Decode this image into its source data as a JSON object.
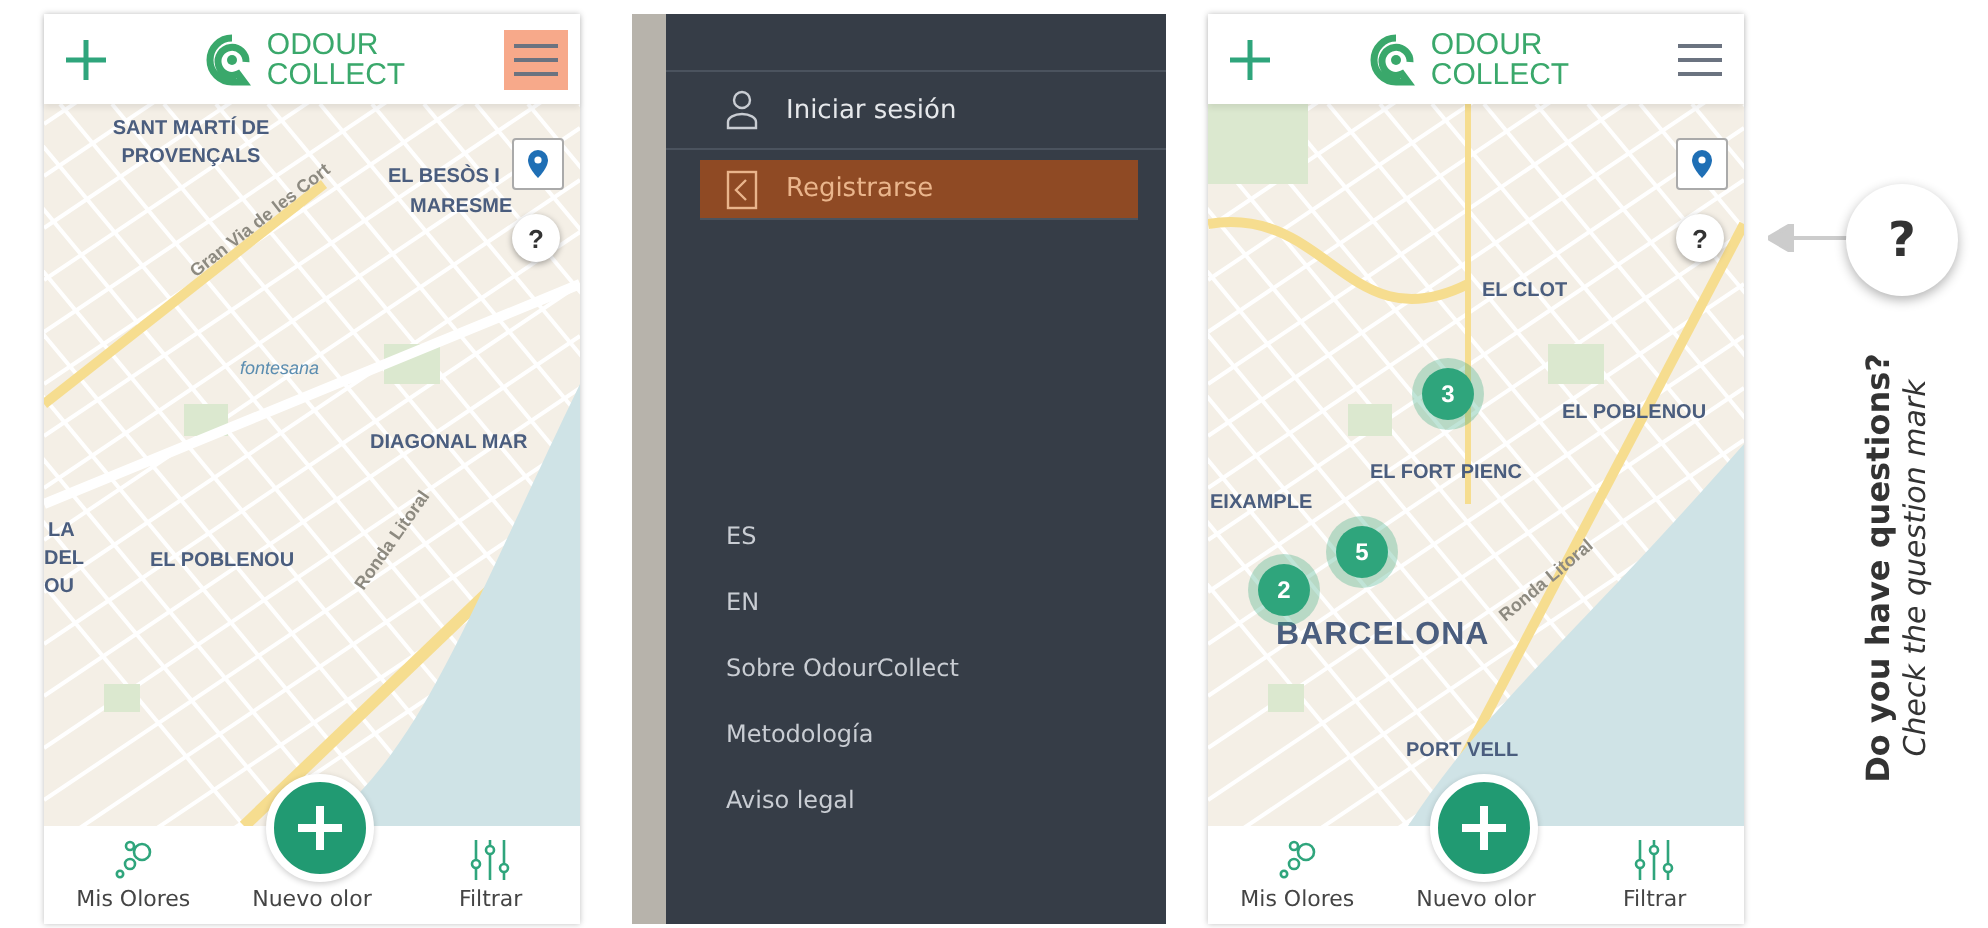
{
  "screens": [
    {
      "kind": "map",
      "header": {
        "logo_top": "ODOUR",
        "logo_bottom": "COLLECT",
        "menu_highlighted": true
      },
      "map_labels": [
        {
          "kind": "district",
          "text": "SANT MARTÍ DE PROVENÇALS"
        },
        {
          "kind": "road",
          "text": "Gran Via de les Cort"
        },
        {
          "kind": "district",
          "text": "EL BESÒS I"
        },
        {
          "kind": "district",
          "text": "MARESME"
        },
        {
          "kind": "park",
          "text": "fontesana"
        },
        {
          "kind": "district",
          "text": "DIAGONAL MAR"
        },
        {
          "kind": "district",
          "text": "LA"
        },
        {
          "kind": "district",
          "text": "DEL"
        },
        {
          "kind": "district",
          "text": "OU"
        },
        {
          "kind": "district",
          "text": "EL POBLENOU"
        },
        {
          "kind": "road",
          "text": "Ronda Litoral"
        }
      ],
      "help_symbol": "?",
      "bottom_nav": [
        "Mis Olores",
        "Nuevo olor",
        "Filtrar"
      ]
    },
    {
      "kind": "menu",
      "menu": [
        {
          "label": "Iniciar sesión",
          "selected": false
        },
        {
          "label": "Registrarse",
          "selected": true
        }
      ],
      "links": [
        "ES",
        "EN",
        "Sobre OdourCollect",
        "Metodología",
        "Aviso legal"
      ]
    },
    {
      "kind": "map",
      "header": {
        "logo_top": "ODOUR",
        "logo_bottom": "COLLECT",
        "menu_highlighted": false
      },
      "map_labels": [
        {
          "kind": "district",
          "text": "EL CLOT"
        },
        {
          "kind": "district",
          "text": "EL POBLENOU"
        },
        {
          "kind": "district",
          "text": "EL FORT PIENC"
        },
        {
          "kind": "district",
          "text": "EIXAMPLE"
        },
        {
          "kind": "city",
          "text": "BARCELONA"
        },
        {
          "kind": "road",
          "text": "Ronda Litoral"
        },
        {
          "kind": "district",
          "text": "PORT VELL"
        }
      ],
      "clusters": [
        "3",
        "5",
        "2"
      ],
      "help_symbol": "?",
      "bottom_nav": [
        "Mis Olores",
        "Nuevo olor",
        "Filtrar"
      ]
    }
  ],
  "callout": {
    "symbol": "?",
    "title": "Do you have questions?",
    "subtitle": "Check the question mark"
  }
}
